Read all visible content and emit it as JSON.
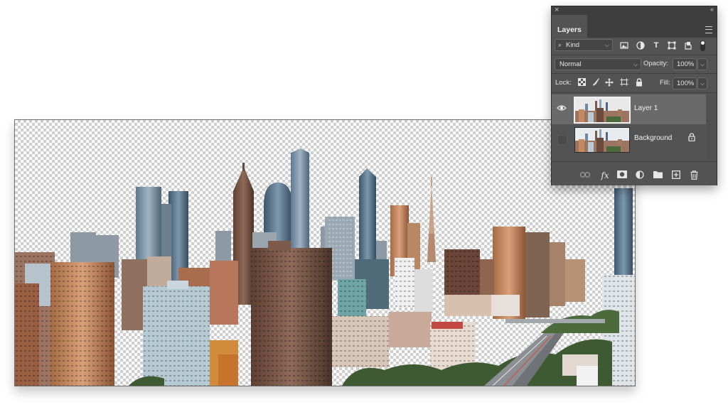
{
  "layers_panel": {
    "close_glyph": "×",
    "collapse_glyph": "‹‹",
    "tab_label": "Layers",
    "filter": {
      "kind_label": "Kind",
      "icons": [
        "image-filter-icon",
        "adjustment-filter-icon",
        "type-filter-icon",
        "shape-filter-icon",
        "smart-object-filter-icon"
      ]
    },
    "blend_mode": "Normal",
    "opacity_label": "Opacity:",
    "opacity_value": "100%",
    "lock_label": "Lock:",
    "lock_icons": [
      "lock-transparent-pixels-icon",
      "lock-image-pixels-icon",
      "lock-position-icon",
      "lock-artboard-icon",
      "lock-all-icon"
    ],
    "fill_label": "Fill:",
    "fill_value": "100%",
    "layers": [
      {
        "name": "Layer 1",
        "visible": true,
        "selected": true,
        "locked": false
      },
      {
        "name": "Background",
        "visible": false,
        "selected": false,
        "locked": true
      }
    ],
    "bottom_icons": [
      "link-layers-icon",
      "layer-style-fx-icon",
      "add-mask-icon",
      "new-adjustment-layer-icon",
      "new-group-icon",
      "new-layer-icon",
      "delete-layer-icon"
    ],
    "fx_label": "fx"
  },
  "canvas": {
    "content": "city-skyline-photo-transparent-sky"
  },
  "colors": {
    "panel_bg": "#535353",
    "panel_dark": "#3e3e3e",
    "selected_row": "#6a6a6a"
  }
}
